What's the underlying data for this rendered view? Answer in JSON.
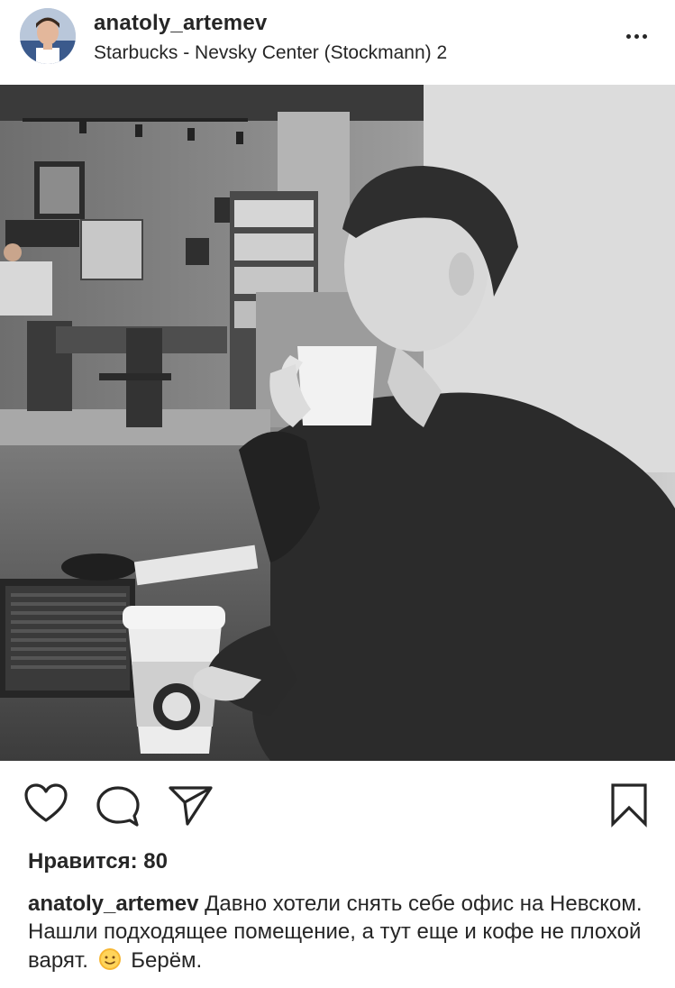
{
  "post": {
    "username": "anatoly_artemev",
    "location": "Starbucks - Nevsky Center (Stockmann) 2",
    "likes_text": "Нравится: 80",
    "caption": {
      "username": "anatoly_artemev",
      "text_before_emoji": "Давно хотели снять себе офис на Невском. Нашли подходящее помещение, а тут еще и кофе не плохой варят.",
      "emoji": "sun-face-emoji",
      "text_after_emoji": "Берём."
    }
  },
  "icons": {
    "more": "more-horizontal-icon",
    "like": "heart-icon",
    "comment": "comment-bubble-icon",
    "share": "paper-plane-icon",
    "save": "bookmark-icon"
  },
  "colors": {
    "text": "#262626",
    "background": "#ffffff"
  }
}
